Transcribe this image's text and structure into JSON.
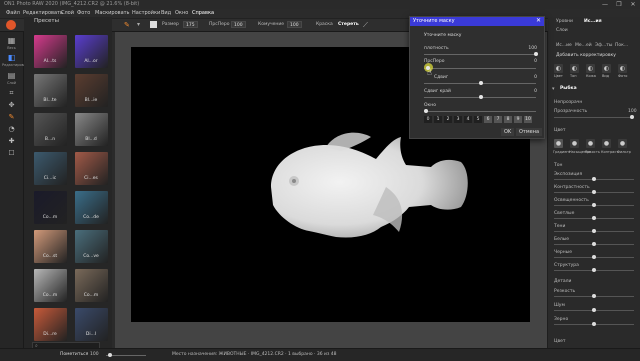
{
  "window": {
    "title": "ON1 Photo RAW 2020 (IMG_4212.CR2 @ 21.6% (8-bit)",
    "controls": [
      "—",
      "❐",
      "✕"
    ]
  },
  "menu": {
    "items": [
      "Файл",
      "Редактировать",
      "Слой",
      "Фото",
      "Маскировать",
      "Настройки",
      "Вид",
      "Окно",
      "Справка"
    ]
  },
  "toolbar": {
    "size_label": "Размер",
    "size_value": "175",
    "feather_label": "ПрсПеро",
    "feather_value": "100",
    "opacity_label": "Комучение",
    "opacity_value": "100",
    "paint_label": "Краска",
    "erase_label": "Стереть"
  },
  "left_tools": {
    "browse_label": "Весь",
    "edit_label": "Редактирование",
    "layers_label": "Слой"
  },
  "presets": {
    "header": "Пресеты",
    "items": [
      {
        "label": "AI...ts",
        "color": "#d63b8d"
      },
      {
        "label": "AI...or",
        "color": "#5a3ed0"
      },
      {
        "label": "Bl...te",
        "color": "#777777"
      },
      {
        "label": "Bl...ie",
        "color": "#5b3d30"
      },
      {
        "label": "B...n",
        "color": "#555555"
      },
      {
        "label": "Bl...d",
        "color": "#888888"
      },
      {
        "label": "Ci...ic",
        "color": "#3c5a6e"
      },
      {
        "label": "Ci...es",
        "color": "#a25a48"
      },
      {
        "label": "Co...m",
        "color": "#1a1a2a"
      },
      {
        "label": "Co...de",
        "color": "#3a6e8a"
      },
      {
        "label": "Co...st",
        "color": "#d29a7a"
      },
      {
        "label": "Co...ve",
        "color": "#4a6e7c"
      },
      {
        "label": "Co...m",
        "color": "#b8b8b8"
      },
      {
        "label": "Co...m",
        "color": "#7a6a5a"
      },
      {
        "label": "Di...re",
        "color": "#c85a3a"
      },
      {
        "label": "Di...l",
        "color": "#3a4a6a"
      }
    ]
  },
  "dialog": {
    "title": "Уточните маску",
    "heading": "Уточните маску",
    "density_label": "плотность",
    "density_value": "100",
    "feather_label": "ПрсПеро",
    "feather_value": "0",
    "shift_label": "Сдвиг",
    "shift_value": "0",
    "edge_label": "Сдвиг край",
    "edge_value": "0",
    "window_label": "Окно",
    "segments": [
      "0",
      "1",
      "2",
      "3",
      "4",
      "5",
      "6",
      "7",
      "8",
      "9",
      "10"
    ],
    "ok_label": "OK",
    "cancel_label": "Отмена"
  },
  "right_panel": {
    "tabs": [
      "Уровни",
      "Ис...ия",
      "Слои"
    ],
    "layers_label": "Слои",
    "subtabs": [
      "Ис...ие",
      "Ме...ей",
      "Эф...ты",
      "Пок..."
    ],
    "add_button": "Добавить корректировку",
    "icon_labels": [
      "Цвет",
      "Тон",
      "Кожа",
      "Вид",
      "Фото"
    ],
    "section_title": "Рыбка",
    "opacity_label": "Непрозрачн",
    "opacity_value": "100",
    "transparency_label": "Прозрачность",
    "color_label": "Цвет",
    "color_icons": [
      "Градиент",
      "Насыщение",
      "Яркость",
      "Контраст",
      "Фильтр"
    ],
    "tone_label": "Тон",
    "tone_sliders": [
      "Экспозиция",
      "Контрастность",
      "Освещенность",
      "Светлые",
      "Тени",
      "Белые",
      "Черные",
      "Структура"
    ],
    "detail_label": "Детали",
    "detail_sliders": [
      "Резкость",
      "Шум",
      "Зерно"
    ],
    "shape_label": "Цвет"
  },
  "status": {
    "mode": "Пометиться",
    "zoom": "100",
    "info": "Место назначения: ЖИВОТНЫЕ · IMG_4212.CR2 · 1 выбрано · 36 из 48"
  }
}
